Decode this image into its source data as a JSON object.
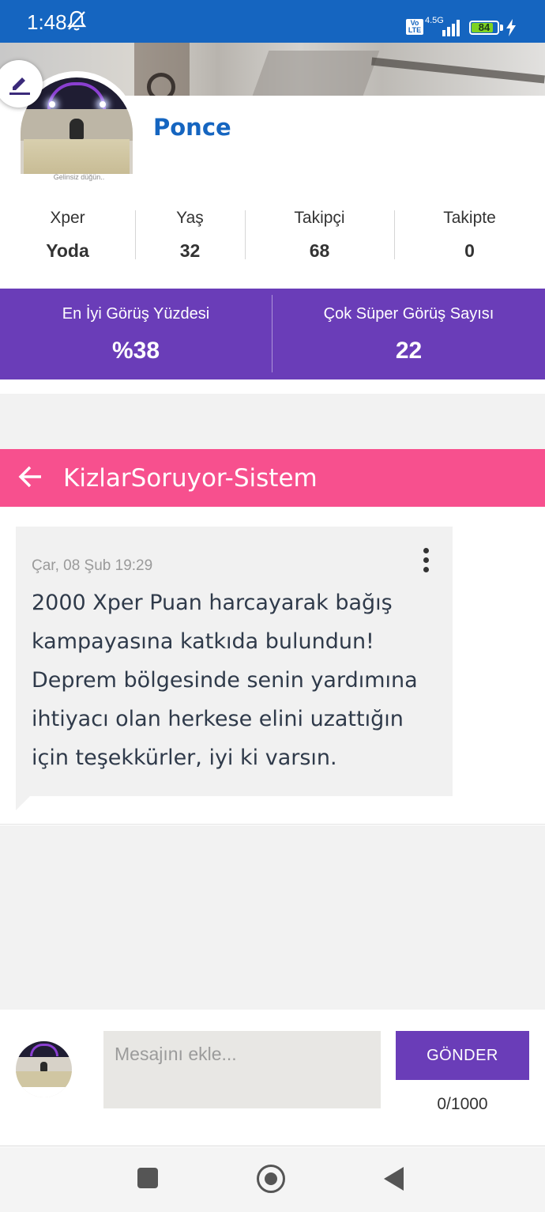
{
  "status_bar": {
    "time": "1:48",
    "volte": "Vo LTE",
    "network": "4.5G",
    "battery": "84",
    "battery_level": 0.84
  },
  "profile": {
    "name": "Ponce",
    "avatar_caption": "Gelinsiz düğün..",
    "stats": [
      {
        "label": "Xper",
        "value": "Yoda"
      },
      {
        "label": "Yaş",
        "value": "32"
      },
      {
        "label": "Takipçi",
        "value": "68"
      },
      {
        "label": "Takipte",
        "value": "0"
      }
    ]
  },
  "highlights": [
    {
      "label": "En İyi Görüş Yüzdesi",
      "value": "%38"
    },
    {
      "label": "Çok Süper Görüş Sayısı",
      "value": "22"
    }
  ],
  "chat": {
    "title": "KizlarSoruyor-Sistem",
    "message": {
      "time": "Çar, 08 Şub 19:29",
      "text": "2000 Xper Puan harcayarak bağış kampayasına katkıda bulundun! Deprem bölgesinde senin yardımına ihtiyacı olan herkese elini uzattığın için teşekkürler, iyi ki varsın."
    }
  },
  "composer": {
    "placeholder": "Mesajını ekle...",
    "value": "",
    "send_label": "GÖNDER",
    "char_count": "0/1000"
  },
  "colors": {
    "status_bar": "#1565c0",
    "name": "#1565c0",
    "purple": "#6a3db8",
    "pink": "#f7508e"
  },
  "icons": [
    "bell-off-icon",
    "signal-icon",
    "battery-icon",
    "charging-icon",
    "edit-icon",
    "back-arrow-icon",
    "more-vertical-icon",
    "nav-recents-icon",
    "nav-home-icon",
    "nav-back-icon"
  ]
}
